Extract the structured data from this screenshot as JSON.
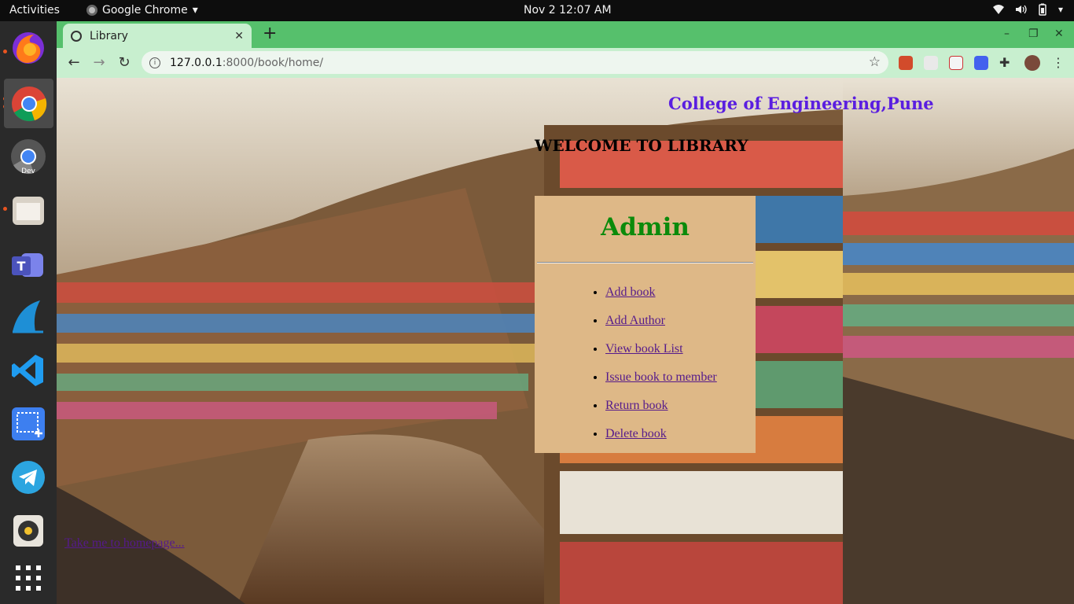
{
  "topbar": {
    "activities": "Activities",
    "app_name": "Google Chrome",
    "clock": "Nov 2  12:07 AM"
  },
  "dock": {
    "items": [
      "firefox-icon",
      "chrome-icon",
      "chrome-dev-icon",
      "files-icon",
      "teams-icon",
      "wireshark-icon",
      "vscode-icon",
      "screenshot-icon",
      "telegram-icon",
      "rhythmbox-icon",
      "app-grid-icon"
    ],
    "dev_label": "Dev"
  },
  "browser": {
    "tab_title": "Library",
    "url_host": "127.0.0.1",
    "url_path": ":8000/book/home/"
  },
  "page": {
    "college": "College of Engineering,Pune",
    "welcome": "WELCOME TO LIBRARY",
    "admin_heading": "Admin",
    "menu": [
      "Add book",
      "Add Author",
      "View book List",
      "Issue book to member",
      "Return book",
      "Delete book"
    ],
    "home_link": "Take me to homepage..."
  },
  "colors": {
    "tab_strip": "#56c06c",
    "panel": "#deb887",
    "admin_heading": "#0b8a0b",
    "college": "#5a1ee0",
    "link": "#551a8b"
  }
}
